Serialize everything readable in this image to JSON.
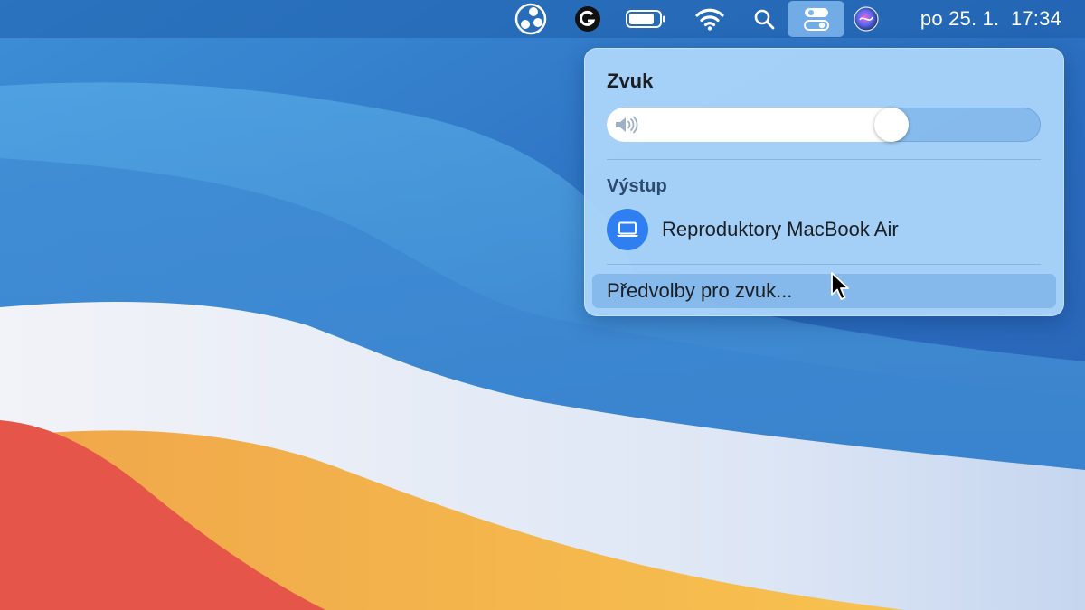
{
  "menubar": {
    "icons": [
      "obs-studio-icon",
      "grammarly-icon",
      "battery-icon",
      "wifi-icon",
      "spotlight-search-icon",
      "control-center-icon",
      "siri-icon"
    ],
    "clock": "po 25. 1.  17:34",
    "active_item": "control-center-icon"
  },
  "sound_panel": {
    "title": "Zvuk",
    "volume": 0.67,
    "output_section_title": "Výstup",
    "output_device": "Reproduktory MacBook Air",
    "preferences_label": "Předvolby pro zvuk..."
  },
  "colors": {
    "accent": "#2f7ff0",
    "panel_background": "#acd6fa",
    "desktop_blue": "#2a6fc0"
  }
}
